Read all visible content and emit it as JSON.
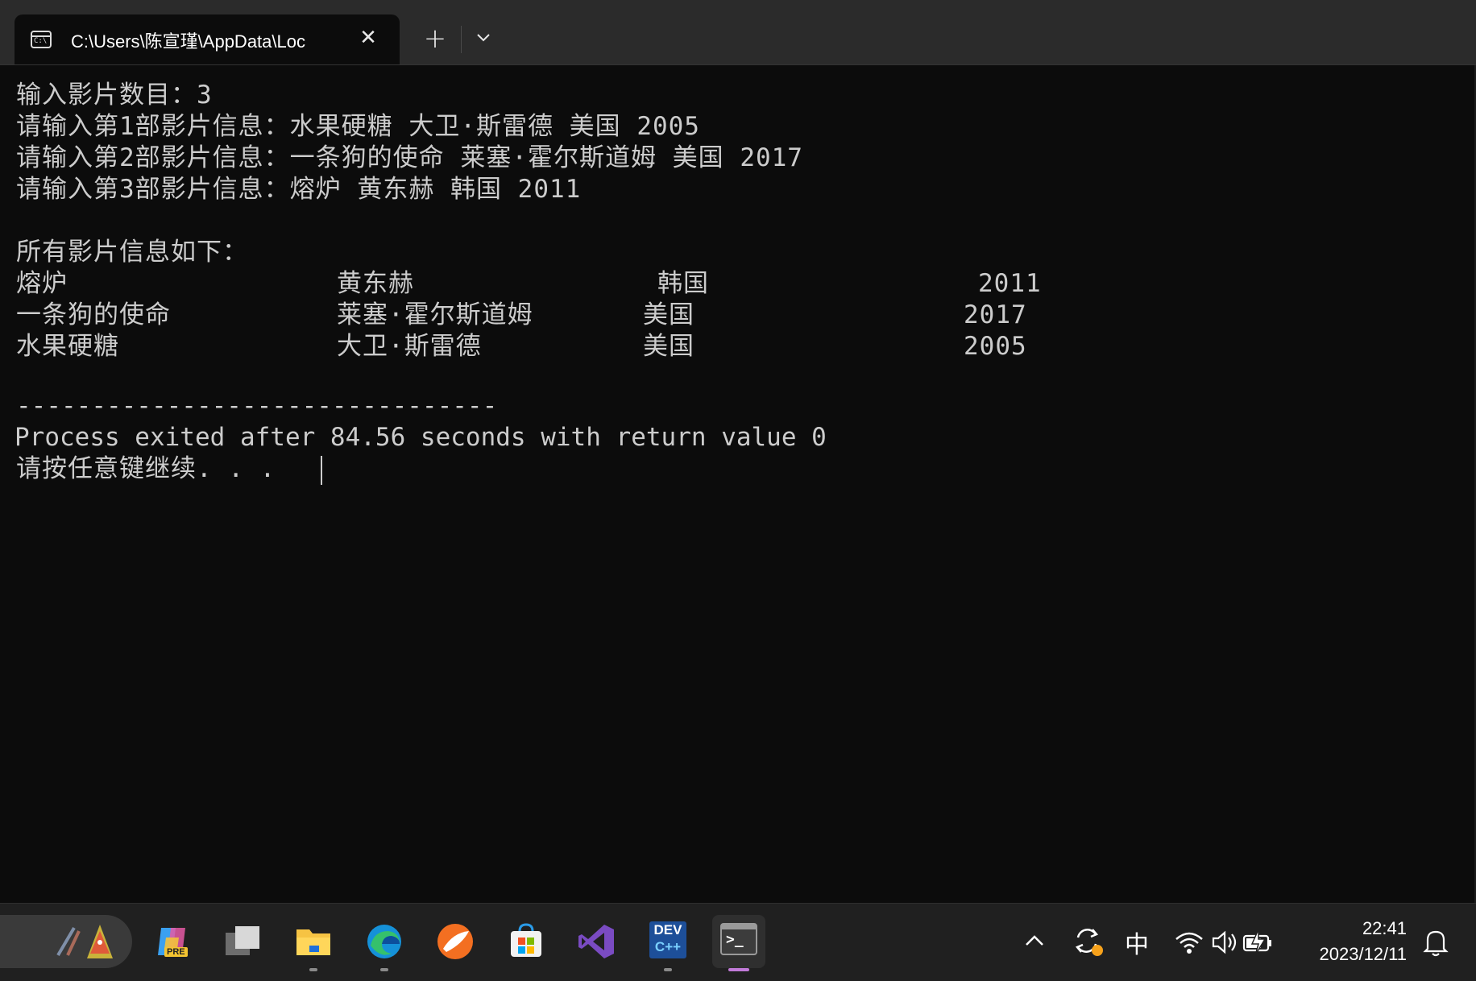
{
  "window": {
    "tab_title": "C:\\Users\\陈宣瑾\\AppData\\Loc",
    "tab_icon_text": "C:\\",
    "close_glyph": "✕",
    "new_tab_glyph": "+"
  },
  "console": {
    "input_lines": [
      "输入影片数目：3",
      "请输入第1部影片信息：水果硬糖 大卫·斯雷德 美国 2005",
      "请输入第2部影片信息：一条狗的使命 莱塞·霍尔斯道姆 美国 2017",
      "请输入第3部影片信息：熔炉 黄东赫 韩国 2011"
    ],
    "list_header": "所有影片信息如下：",
    "movies": [
      {
        "title": "熔炉",
        "director": "黄东赫",
        "country": "韩国",
        "year": "2011"
      },
      {
        "title": "一条狗的使命",
        "director": "莱塞·霍尔斯道姆",
        "country": "美国",
        "year": "2017"
      },
      {
        "title": "水果硬糖",
        "director": "大卫·斯雷德",
        "country": "美国",
        "year": "2005"
      }
    ],
    "separator": "--------------------------------",
    "exit_message": "Process exited after 84.56 seconds with return value 0",
    "prompt": "请按任意键继续. . ."
  },
  "taskbar": {
    "apps": [
      {
        "name": "copilot-pre",
        "badge": "PRE"
      },
      {
        "name": "task-view"
      },
      {
        "name": "file-explorer"
      },
      {
        "name": "edge"
      },
      {
        "name": "orange-app"
      },
      {
        "name": "microsoft-store"
      },
      {
        "name": "visual-studio"
      },
      {
        "name": "dev-cpp",
        "label_top": "DEV",
        "label_bottom": "C++"
      },
      {
        "name": "terminal",
        "glyph": ">_"
      }
    ],
    "tray": {
      "ime": "中",
      "time": "22:41",
      "date": "2023/12/11"
    }
  }
}
